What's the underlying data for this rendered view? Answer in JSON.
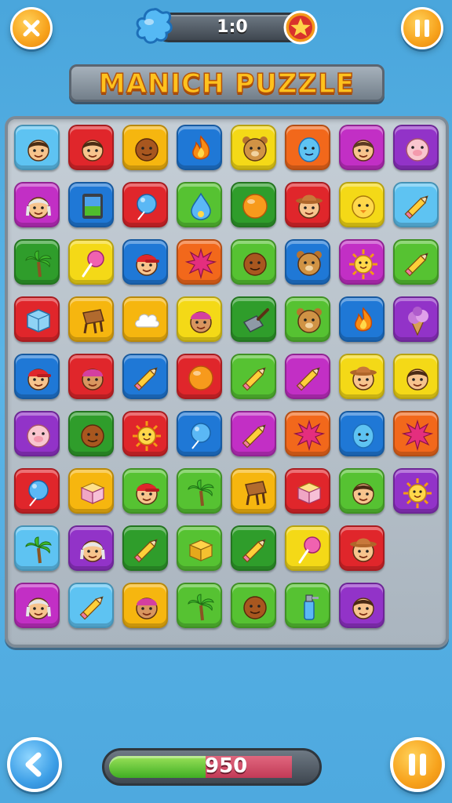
{
  "header": {
    "score_display": "1:0",
    "close_icon": "close-icon",
    "pause_icon": "pause-icon",
    "splat_icon": "blue-splat-icon",
    "star_icon": "star-badge-icon"
  },
  "title": "MANICH PUZZLE",
  "board": {
    "tiles": [
      {
        "color": "#5ec3f2",
        "icon": "boy-face-icon"
      },
      {
        "color": "#e0262b",
        "icon": "boy-face-icon"
      },
      {
        "color": "#f6b60f",
        "icon": "ball-face-icon"
      },
      {
        "color": "#1f78d6",
        "icon": "flame-icon"
      },
      {
        "color": "#f4d917",
        "icon": "bear-face-icon"
      },
      {
        "color": "#f2681b",
        "icon": "blob-face-icon"
      },
      {
        "color": "#c22fc5",
        "icon": "girl-face-icon"
      },
      {
        "color": "#9233c8",
        "icon": "pig-face-icon"
      },
      {
        "color": "#c22fc5",
        "icon": "grandma-face-icon"
      },
      {
        "color": "#1f78d6",
        "icon": "tablet-icon"
      },
      {
        "color": "#e0262b",
        "icon": "balloon-icon"
      },
      {
        "color": "#56c232",
        "icon": "drop-icon"
      },
      {
        "color": "#2f9d2b",
        "icon": "orange-ball-icon"
      },
      {
        "color": "#e0262b",
        "icon": "cowboy-face-icon"
      },
      {
        "color": "#f4d917",
        "icon": "chick-face-icon"
      },
      {
        "color": "#5ec3f2",
        "icon": "pencil-icon"
      },
      {
        "color": "#2f9d2b",
        "icon": "palm-tree-icon"
      },
      {
        "color": "#f4d917",
        "icon": "lollipop-icon"
      },
      {
        "color": "#1f78d6",
        "icon": "boy-cap-face-icon"
      },
      {
        "color": "#f2681b",
        "icon": "burst-icon"
      },
      {
        "color": "#56c232",
        "icon": "ball-face-icon"
      },
      {
        "color": "#1f78d6",
        "icon": "bear-face-icon"
      },
      {
        "color": "#c22fc5",
        "icon": "sun-face-icon"
      },
      {
        "color": "#56c232",
        "icon": "pencil-icon"
      },
      {
        "color": "#e0262b",
        "icon": "ice-cube-icon"
      },
      {
        "color": "#f6b60f",
        "icon": "stool-icon"
      },
      {
        "color": "#f6b60f",
        "icon": "cloud-icon"
      },
      {
        "color": "#f4d917",
        "icon": "girl-cap-face-icon"
      },
      {
        "color": "#2f9d2b",
        "icon": "shovel-icon"
      },
      {
        "color": "#56c232",
        "icon": "bear-face-icon"
      },
      {
        "color": "#1f78d6",
        "icon": "flame-icon"
      },
      {
        "color": "#9233c8",
        "icon": "ice-cream-icon"
      },
      {
        "color": "#1f78d6",
        "icon": "boy-cap-face-icon"
      },
      {
        "color": "#e0262b",
        "icon": "girl-cap-face-icon"
      },
      {
        "color": "#1f78d6",
        "icon": "pencil-icon"
      },
      {
        "color": "#e0262b",
        "icon": "orange-ball-icon"
      },
      {
        "color": "#56c232",
        "icon": "pencil-icon"
      },
      {
        "color": "#c22fc5",
        "icon": "pencil-icon"
      },
      {
        "color": "#f4d917",
        "icon": "cowboy-face-icon"
      },
      {
        "color": "#f4d917",
        "icon": "boy-face-icon"
      },
      {
        "color": "#9233c8",
        "icon": "pig-face-icon"
      },
      {
        "color": "#2f9d2b",
        "icon": "ball-face-icon"
      },
      {
        "color": "#e0262b",
        "icon": "sun-face-icon"
      },
      {
        "color": "#1f78d6",
        "icon": "balloon-icon"
      },
      {
        "color": "#c22fc5",
        "icon": "pencil-icon"
      },
      {
        "color": "#f2681b",
        "icon": "burst-icon"
      },
      {
        "color": "#1f78d6",
        "icon": "blob-face-icon"
      },
      {
        "color": "#f2681b",
        "icon": "burst-icon"
      },
      {
        "color": "#e0262b",
        "icon": "balloon-icon"
      },
      {
        "color": "#f6b60f",
        "icon": "cake-icon"
      },
      {
        "color": "#56c232",
        "icon": "boy-cap-face-icon"
      },
      {
        "color": "#56c232",
        "icon": "palm-tree-icon"
      },
      {
        "color": "#f6b60f",
        "icon": "stool-icon"
      },
      {
        "color": "#e0262b",
        "icon": "cake-icon"
      },
      {
        "color": "#56c232",
        "icon": "boy-face-icon"
      },
      {
        "color": "#9233c8",
        "icon": "sun-face-icon"
      },
      {
        "color": "#5ec3f2",
        "icon": "palm-tree-icon"
      },
      {
        "color": "#9233c8",
        "icon": "grandma-face-icon"
      },
      {
        "color": "#2f9d2b",
        "icon": "pencil-icon"
      },
      {
        "color": "#56c232",
        "icon": "box-icon"
      },
      {
        "color": "#2f9d2b",
        "icon": "pencil-icon"
      },
      {
        "color": "#f4d917",
        "icon": "lollipop-icon"
      },
      {
        "color": "#e0262b",
        "icon": "cowboy-face-icon"
      },
      null,
      {
        "color": "#c22fc5",
        "icon": "grandma-face-icon"
      },
      {
        "color": "#5ec3f2",
        "icon": "pencil-icon"
      },
      {
        "color": "#f6b60f",
        "icon": "girl-cap-face-icon"
      },
      {
        "color": "#56c232",
        "icon": "palm-tree-icon"
      },
      {
        "color": "#56c232",
        "icon": "ball-face-icon"
      },
      {
        "color": "#56c232",
        "icon": "bottle-icon"
      },
      {
        "color": "#9233c8",
        "icon": "boy-face-icon"
      },
      null
    ]
  },
  "footer": {
    "back_icon": "back-arrow-icon",
    "pause_icon": "pause-icon",
    "score": "950",
    "progress": 0.47
  }
}
